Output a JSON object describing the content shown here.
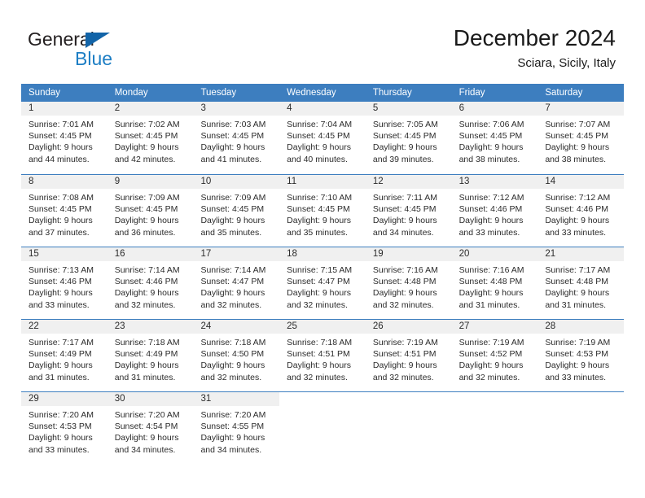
{
  "brand": {
    "name_top": "General",
    "name_bottom": "Blue",
    "accent_color": "#1d7ec4",
    "triangle_color": "#1264a8"
  },
  "header": {
    "title": "December 2024",
    "subtitle": "Sciara, Sicily, Italy"
  },
  "calendar": {
    "header_bg": "#3d7ebf",
    "daynum_bg": "#f0f0f0",
    "weekdays": [
      "Sunday",
      "Monday",
      "Tuesday",
      "Wednesday",
      "Thursday",
      "Friday",
      "Saturday"
    ],
    "weeks": [
      [
        {
          "day": "1",
          "sunrise": "Sunrise: 7:01 AM",
          "sunset": "Sunset: 4:45 PM",
          "daylight_1": "Daylight: 9 hours",
          "daylight_2": "and 44 minutes."
        },
        {
          "day": "2",
          "sunrise": "Sunrise: 7:02 AM",
          "sunset": "Sunset: 4:45 PM",
          "daylight_1": "Daylight: 9 hours",
          "daylight_2": "and 42 minutes."
        },
        {
          "day": "3",
          "sunrise": "Sunrise: 7:03 AM",
          "sunset": "Sunset: 4:45 PM",
          "daylight_1": "Daylight: 9 hours",
          "daylight_2": "and 41 minutes."
        },
        {
          "day": "4",
          "sunrise": "Sunrise: 7:04 AM",
          "sunset": "Sunset: 4:45 PM",
          "daylight_1": "Daylight: 9 hours",
          "daylight_2": "and 40 minutes."
        },
        {
          "day": "5",
          "sunrise": "Sunrise: 7:05 AM",
          "sunset": "Sunset: 4:45 PM",
          "daylight_1": "Daylight: 9 hours",
          "daylight_2": "and 39 minutes."
        },
        {
          "day": "6",
          "sunrise": "Sunrise: 7:06 AM",
          "sunset": "Sunset: 4:45 PM",
          "daylight_1": "Daylight: 9 hours",
          "daylight_2": "and 38 minutes."
        },
        {
          "day": "7",
          "sunrise": "Sunrise: 7:07 AM",
          "sunset": "Sunset: 4:45 PM",
          "daylight_1": "Daylight: 9 hours",
          "daylight_2": "and 38 minutes."
        }
      ],
      [
        {
          "day": "8",
          "sunrise": "Sunrise: 7:08 AM",
          "sunset": "Sunset: 4:45 PM",
          "daylight_1": "Daylight: 9 hours",
          "daylight_2": "and 37 minutes."
        },
        {
          "day": "9",
          "sunrise": "Sunrise: 7:09 AM",
          "sunset": "Sunset: 4:45 PM",
          "daylight_1": "Daylight: 9 hours",
          "daylight_2": "and 36 minutes."
        },
        {
          "day": "10",
          "sunrise": "Sunrise: 7:09 AM",
          "sunset": "Sunset: 4:45 PM",
          "daylight_1": "Daylight: 9 hours",
          "daylight_2": "and 35 minutes."
        },
        {
          "day": "11",
          "sunrise": "Sunrise: 7:10 AM",
          "sunset": "Sunset: 4:45 PM",
          "daylight_1": "Daylight: 9 hours",
          "daylight_2": "and 35 minutes."
        },
        {
          "day": "12",
          "sunrise": "Sunrise: 7:11 AM",
          "sunset": "Sunset: 4:45 PM",
          "daylight_1": "Daylight: 9 hours",
          "daylight_2": "and 34 minutes."
        },
        {
          "day": "13",
          "sunrise": "Sunrise: 7:12 AM",
          "sunset": "Sunset: 4:46 PM",
          "daylight_1": "Daylight: 9 hours",
          "daylight_2": "and 33 minutes."
        },
        {
          "day": "14",
          "sunrise": "Sunrise: 7:12 AM",
          "sunset": "Sunset: 4:46 PM",
          "daylight_1": "Daylight: 9 hours",
          "daylight_2": "and 33 minutes."
        }
      ],
      [
        {
          "day": "15",
          "sunrise": "Sunrise: 7:13 AM",
          "sunset": "Sunset: 4:46 PM",
          "daylight_1": "Daylight: 9 hours",
          "daylight_2": "and 33 minutes."
        },
        {
          "day": "16",
          "sunrise": "Sunrise: 7:14 AM",
          "sunset": "Sunset: 4:46 PM",
          "daylight_1": "Daylight: 9 hours",
          "daylight_2": "and 32 minutes."
        },
        {
          "day": "17",
          "sunrise": "Sunrise: 7:14 AM",
          "sunset": "Sunset: 4:47 PM",
          "daylight_1": "Daylight: 9 hours",
          "daylight_2": "and 32 minutes."
        },
        {
          "day": "18",
          "sunrise": "Sunrise: 7:15 AM",
          "sunset": "Sunset: 4:47 PM",
          "daylight_1": "Daylight: 9 hours",
          "daylight_2": "and 32 minutes."
        },
        {
          "day": "19",
          "sunrise": "Sunrise: 7:16 AM",
          "sunset": "Sunset: 4:48 PM",
          "daylight_1": "Daylight: 9 hours",
          "daylight_2": "and 32 minutes."
        },
        {
          "day": "20",
          "sunrise": "Sunrise: 7:16 AM",
          "sunset": "Sunset: 4:48 PM",
          "daylight_1": "Daylight: 9 hours",
          "daylight_2": "and 31 minutes."
        },
        {
          "day": "21",
          "sunrise": "Sunrise: 7:17 AM",
          "sunset": "Sunset: 4:48 PM",
          "daylight_1": "Daylight: 9 hours",
          "daylight_2": "and 31 minutes."
        }
      ],
      [
        {
          "day": "22",
          "sunrise": "Sunrise: 7:17 AM",
          "sunset": "Sunset: 4:49 PM",
          "daylight_1": "Daylight: 9 hours",
          "daylight_2": "and 31 minutes."
        },
        {
          "day": "23",
          "sunrise": "Sunrise: 7:18 AM",
          "sunset": "Sunset: 4:49 PM",
          "daylight_1": "Daylight: 9 hours",
          "daylight_2": "and 31 minutes."
        },
        {
          "day": "24",
          "sunrise": "Sunrise: 7:18 AM",
          "sunset": "Sunset: 4:50 PM",
          "daylight_1": "Daylight: 9 hours",
          "daylight_2": "and 32 minutes."
        },
        {
          "day": "25",
          "sunrise": "Sunrise: 7:18 AM",
          "sunset": "Sunset: 4:51 PM",
          "daylight_1": "Daylight: 9 hours",
          "daylight_2": "and 32 minutes."
        },
        {
          "day": "26",
          "sunrise": "Sunrise: 7:19 AM",
          "sunset": "Sunset: 4:51 PM",
          "daylight_1": "Daylight: 9 hours",
          "daylight_2": "and 32 minutes."
        },
        {
          "day": "27",
          "sunrise": "Sunrise: 7:19 AM",
          "sunset": "Sunset: 4:52 PM",
          "daylight_1": "Daylight: 9 hours",
          "daylight_2": "and 32 minutes."
        },
        {
          "day": "28",
          "sunrise": "Sunrise: 7:19 AM",
          "sunset": "Sunset: 4:53 PM",
          "daylight_1": "Daylight: 9 hours",
          "daylight_2": "and 33 minutes."
        }
      ],
      [
        {
          "day": "29",
          "sunrise": "Sunrise: 7:20 AM",
          "sunset": "Sunset: 4:53 PM",
          "daylight_1": "Daylight: 9 hours",
          "daylight_2": "and 33 minutes."
        },
        {
          "day": "30",
          "sunrise": "Sunrise: 7:20 AM",
          "sunset": "Sunset: 4:54 PM",
          "daylight_1": "Daylight: 9 hours",
          "daylight_2": "and 34 minutes."
        },
        {
          "day": "31",
          "sunrise": "Sunrise: 7:20 AM",
          "sunset": "Sunset: 4:55 PM",
          "daylight_1": "Daylight: 9 hours",
          "daylight_2": "and 34 minutes."
        },
        {
          "day": "",
          "sunrise": "",
          "sunset": "",
          "daylight_1": "",
          "daylight_2": ""
        },
        {
          "day": "",
          "sunrise": "",
          "sunset": "",
          "daylight_1": "",
          "daylight_2": ""
        },
        {
          "day": "",
          "sunrise": "",
          "sunset": "",
          "daylight_1": "",
          "daylight_2": ""
        },
        {
          "day": "",
          "sunrise": "",
          "sunset": "",
          "daylight_1": "",
          "daylight_2": ""
        }
      ]
    ]
  }
}
